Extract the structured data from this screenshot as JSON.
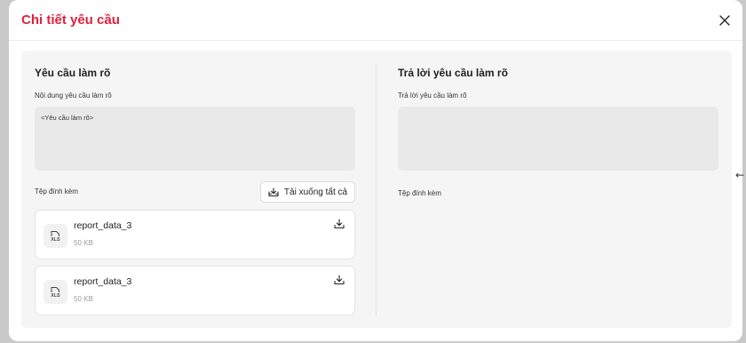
{
  "modal": {
    "title": "Chi tiết yêu cầu"
  },
  "left": {
    "section_title": "Yêu cầu làm rõ",
    "content_label": "Nội dung yêu cầu làm rõ",
    "content_value": "<Yêu cầu làm rõ>",
    "attachments_label": "Tệp đính kèm",
    "download_all_label": "Tải xuống tất cả",
    "files": [
      {
        "name": "report_data_3",
        "size": "50 KB",
        "ext": "XLS"
      },
      {
        "name": "report_data_3",
        "size": "50 KB",
        "ext": "XLS"
      }
    ]
  },
  "right": {
    "section_title": "Trả lời yêu cầu làm rõ",
    "reply_label": "Trả lời yêu cầu làm rõ",
    "reply_value": "",
    "attachments_label": "Tệp đính kèm"
  },
  "side_arrow": "←",
  "colors": {
    "accent": "#e0203c",
    "panel_bg": "#f5f5f5",
    "field_bg": "#e9e9e9"
  },
  "icons": {
    "close": "close-icon",
    "download": "download-icon",
    "file": "xls-file-icon"
  }
}
